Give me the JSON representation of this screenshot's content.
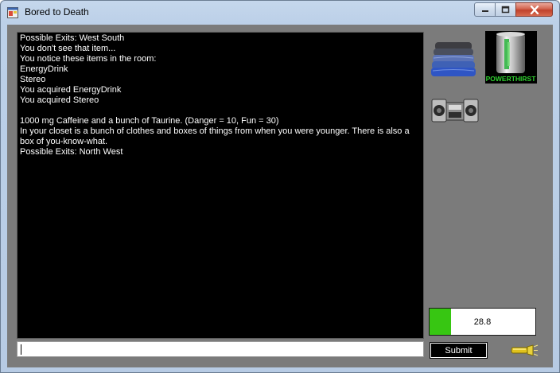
{
  "window": {
    "title": "Bored to Death",
    "icons": {
      "app": "app-window-icon",
      "minimize": "minimize-icon",
      "maximize": "maximize-icon",
      "close": "close-icon"
    }
  },
  "console": {
    "lines": [
      "Possible Exits: West South",
      "You don't see that item...",
      "You notice these items in the room:",
      "EnergyDrink",
      "Stereo",
      "You acquired EnergyDrink",
      "You acquired Stereo",
      "",
      "1000 mg Caffeine and a bunch of Taurine. (Danger = 10, Fun = 30)",
      "In your closet is a bunch of clothes and boxes of things from when you were younger. There is also a box of you-know-what.",
      "Possible Exits: North West"
    ]
  },
  "command_input": {
    "value": ""
  },
  "inventory": {
    "items": [
      {
        "name": "clothes-icon"
      },
      {
        "name": "energy-drink-icon",
        "label": "POWERTHIRST"
      },
      {
        "name": "stereo-icon"
      }
    ]
  },
  "meter": {
    "value_text": "28.8",
    "fill_fraction": 0.2,
    "fill_color": "#37c612"
  },
  "submit_button": {
    "label": "Submit"
  },
  "flashlight": {
    "icon": "flashlight-icon"
  },
  "colors": {
    "client_bg": "#7b7b7b",
    "console_bg": "#000000",
    "console_text": "#ffffff"
  }
}
